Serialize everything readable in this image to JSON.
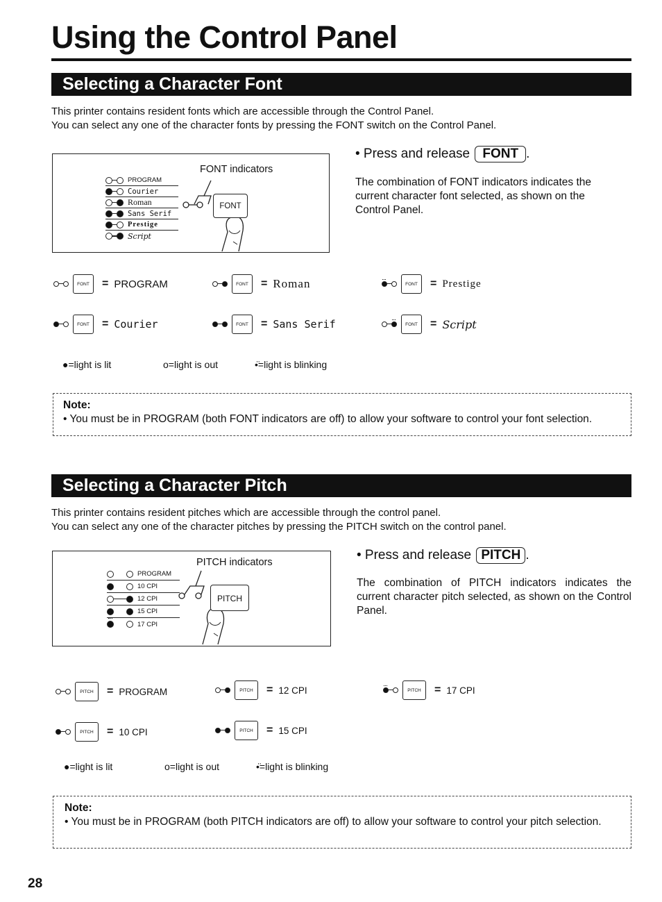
{
  "page": {
    "title": "Using the Control Panel",
    "page_number": "28"
  },
  "font_section": {
    "heading": "Selecting a Character Font",
    "intro_line1": "This printer contains resident fonts which are accessible through the Control Panel.",
    "intro_line2": "You can select any one of the character fonts by pressing the FONT switch on the Control Panel.",
    "panel": {
      "indicators_label": "FONT indicators",
      "key_label": "FONT",
      "rows": [
        {
          "label": "PROGRAM",
          "left": "out",
          "right": "out"
        },
        {
          "label": "Courier",
          "left": "lit",
          "right": "out"
        },
        {
          "label": "Roman",
          "left": "out",
          "right": "lit"
        },
        {
          "label": "Sans Serif",
          "left": "lit",
          "right": "lit"
        },
        {
          "label": "Prestige",
          "left": "blinking",
          "right": "out"
        },
        {
          "label": "Script",
          "left": "out",
          "right": "blinking"
        }
      ]
    },
    "press_prefix": "• Press and release",
    "press_key": "FONT",
    "press_suffix": ".",
    "description": "The combination of FONT indicators indicates the current character font selected, as shown on the Control Panel.",
    "combos": [
      {
        "key": "FONT",
        "equals": "=",
        "value": "PROGRAM"
      },
      {
        "key": "FONT",
        "equals": "=",
        "value": "Roman"
      },
      {
        "key": "FONT",
        "equals": "=",
        "value": "Prestige"
      },
      {
        "key": "FONT",
        "equals": "=",
        "value": "Courier"
      },
      {
        "key": "FONT",
        "equals": "=",
        "value": "Sans Serif"
      },
      {
        "key": "FONT",
        "equals": "=",
        "value": "Script"
      }
    ],
    "legend": {
      "lit": "●=light is lit",
      "out": "o=light is out",
      "blinking": "=light is blinking"
    },
    "note": {
      "title": "Note:",
      "text": "• You must be in PROGRAM (both FONT indicators are off) to allow your software to control your font selection."
    }
  },
  "pitch_section": {
    "heading": "Selecting a Character Pitch",
    "intro_line1": "This printer contains resident pitches which are accessible through the control panel.",
    "intro_line2": "You can select any one of the character pitches by pressing the PITCH switch on the control panel.",
    "panel": {
      "indicators_label": "PITCH indicators",
      "key_label": "PITCH",
      "rows": [
        {
          "label": "PROGRAM",
          "left": "out",
          "right": "out"
        },
        {
          "label": "10 CPI",
          "left": "lit",
          "right": "out"
        },
        {
          "label": "12 CPI",
          "left": "out",
          "right": "lit"
        },
        {
          "label": "15 CPI",
          "left": "lit",
          "right": "lit"
        },
        {
          "label": "17 CPI",
          "left": "blinking",
          "right": "out"
        }
      ]
    },
    "press_prefix": "• Press and release",
    "press_key": "PITCH",
    "press_suffix": ".",
    "description": "The combination of PITCH indicators indicates the current character pitch selected, as shown on the Control Panel.",
    "combos": [
      {
        "key": "PITCH",
        "equals": "=",
        "value": "PROGRAM"
      },
      {
        "key": "PITCH",
        "equals": "=",
        "value": "12 CPI"
      },
      {
        "key": "PITCH",
        "equals": "=",
        "value": "17 CPI"
      },
      {
        "key": "PITCH",
        "equals": "=",
        "value": "10 CPI"
      },
      {
        "key": "PITCH",
        "equals": "=",
        "value": "15 CPI"
      }
    ],
    "legend": {
      "lit": "●=light is lit",
      "out": "o=light is out",
      "blinking": "=light is blinking"
    },
    "note": {
      "title": "Note:",
      "text": "• You must be in PROGRAM (both PITCH indicators are off) to allow your software to control your pitch selection."
    }
  }
}
